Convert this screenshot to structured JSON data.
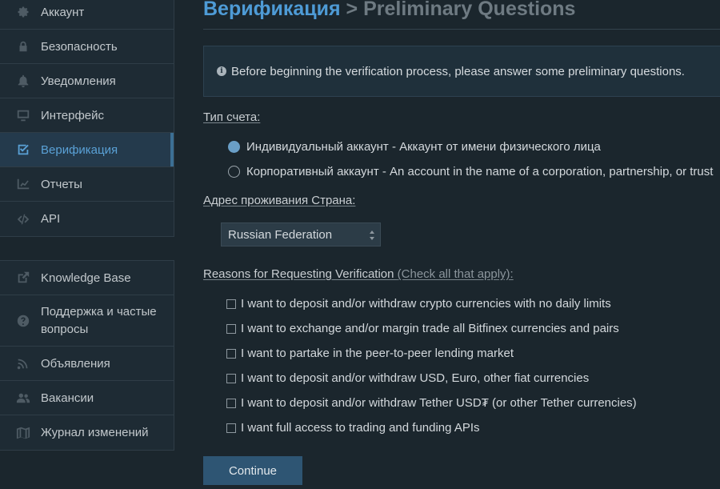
{
  "sidebar": {
    "account_items": [
      {
        "label": "Аккаунт",
        "icon": "gear-icon"
      },
      {
        "label": "Безопасность",
        "icon": "lock-icon"
      },
      {
        "label": "Уведомления",
        "icon": "bell-icon"
      },
      {
        "label": "Интерфейс",
        "icon": "monitor-icon"
      },
      {
        "label": "Верификация",
        "icon": "checkbox-icon"
      },
      {
        "label": "Отчеты",
        "icon": "chart-icon"
      },
      {
        "label": "API",
        "icon": "code-icon"
      }
    ],
    "active_item": "Верификация",
    "support_items": [
      {
        "label": "Knowledge Base",
        "icon": "external-link-icon"
      },
      {
        "label": "Поддержка и частые вопросы",
        "icon": "question-icon"
      },
      {
        "label": "Объявления",
        "icon": "rss-icon"
      },
      {
        "label": "Вакансии",
        "icon": "users-icon"
      },
      {
        "label": "Журнал изменений",
        "icon": "map-icon"
      }
    ]
  },
  "header": {
    "breadcrumb": "Верификация",
    "separator": " > ",
    "title": "Preliminary Questions"
  },
  "info": {
    "text": "Before beginning the verification process, please answer some preliminary questions."
  },
  "account_type": {
    "label": "Тип счета:",
    "options": [
      {
        "label": "Индивидуальный аккаунт - Аккаунт от имени физического лица",
        "checked": true
      },
      {
        "label": "Корпоративный аккаунт - An account in the name of a corporation, partnership, or trust",
        "checked": false
      }
    ]
  },
  "country": {
    "label": "Адрес проживания Страна:",
    "selected": "Russian Federation"
  },
  "reasons": {
    "label": "Reasons for Requesting Verification",
    "hint": "(Check all that apply):",
    "options": [
      "I want to deposit and/or withdraw crypto currencies with no daily limits",
      "I want to exchange and/or margin trade all Bitfinex currencies and pairs",
      "I want to partake in the peer-to-peer lending market",
      "I want to deposit and/or withdraw USD, Euro, other fiat currencies",
      "I want to deposit and/or withdraw Tether USD₮ (or other Tether currencies)",
      "I want full access to trading and funding APIs"
    ]
  },
  "actions": {
    "continue_label": "Continue"
  },
  "colors": {
    "background": "#1b262d",
    "accent": "#4e9bd6",
    "button": "#2e5573"
  }
}
